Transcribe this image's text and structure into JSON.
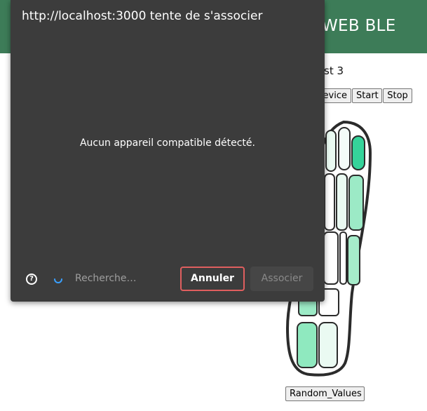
{
  "page": {
    "header_title": "WEB BLE",
    "subtitle_partial": "st 3",
    "buttons": {
      "device_partial": "evice",
      "start": "Start",
      "stop": "Stop",
      "random": "Random_Values"
    }
  },
  "dialog": {
    "title": "http://localhost:3000 tente de s'associer",
    "message": "Aucun appareil compatible détecté.",
    "help_icon": "?",
    "search_placeholder": "Recherche…",
    "cancel_label": "Annuler",
    "associate_label": "Associer"
  },
  "colors": {
    "header_green": "#3d7c58",
    "dialog_bg": "#3c3c3c",
    "cancel_border": "#e05f5f",
    "spinner_blue": "#3aa0ff"
  }
}
